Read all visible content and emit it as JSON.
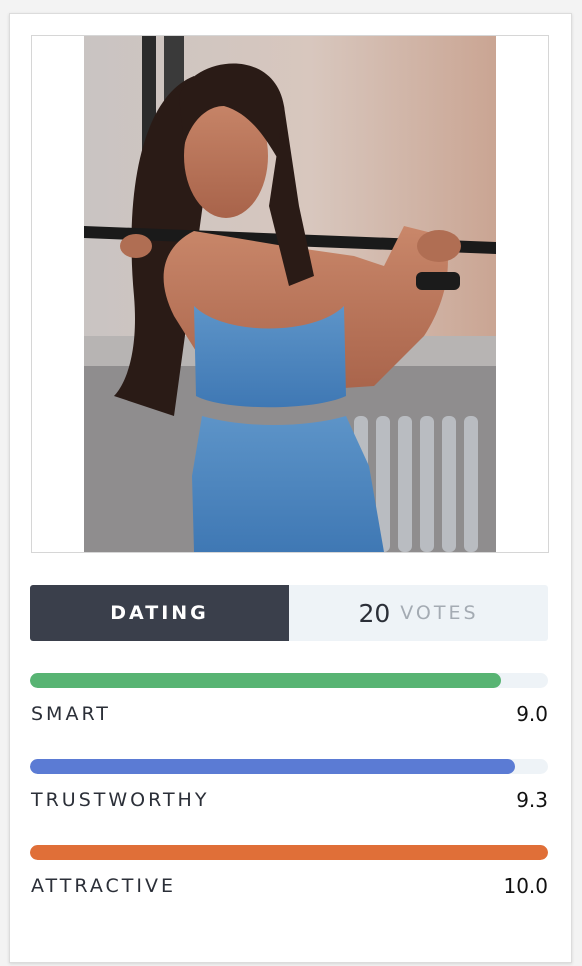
{
  "category": {
    "label": "DATING"
  },
  "votes": {
    "count": "20",
    "label": "VOTES"
  },
  "metrics": [
    {
      "label": "SMART",
      "score": "9.0",
      "fraction": 0.91,
      "color": "#58b473"
    },
    {
      "label": "TRUSTWORTHY",
      "score": "9.3",
      "fraction": 0.937,
      "color": "#5b7bd4"
    },
    {
      "label": "ATTRACTIVE",
      "score": "10.0",
      "fraction": 1.0,
      "color": "#e06f38"
    }
  ]
}
